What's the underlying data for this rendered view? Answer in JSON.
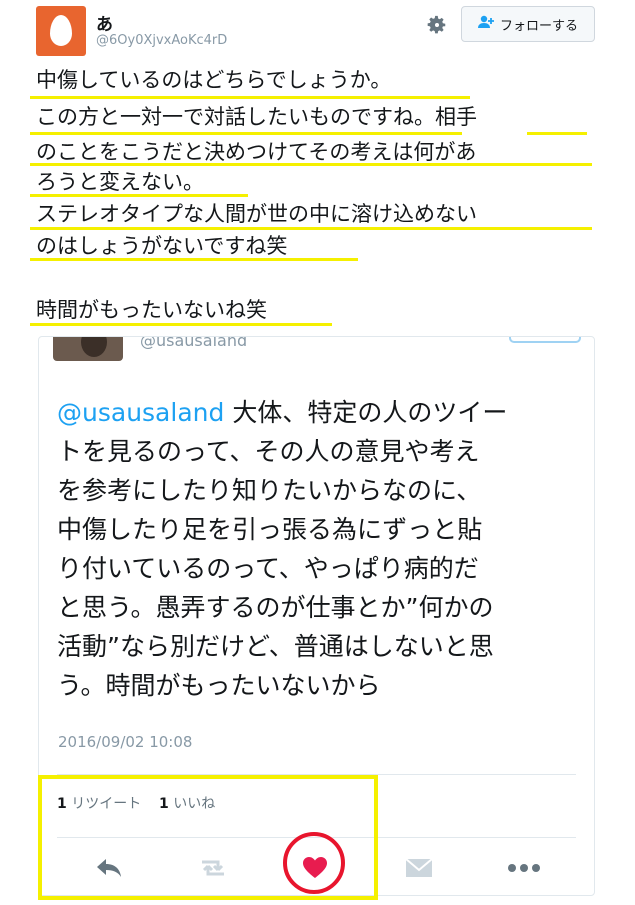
{
  "header": {
    "display_name": "あ",
    "handle": "@6Oy0XjvxAoKc4rD",
    "follow_label": "フォローする"
  },
  "tweet": {
    "lines": [
      "中傷しているのはどちらでしょうか。",
      "この方と一対一で対話したいものですね。相手",
      "のことをこうだと決めつけてその考えは何があ",
      "ろうと変えない。",
      "ステレオタイプな人間が世の中に溶け込めない",
      "のはしょうがないですね笑",
      "時間がもったいないね笑"
    ]
  },
  "quoted_tweet": {
    "handle": "@usausaland",
    "mention": "@usausaland",
    "lines": [
      "大体、特定の人のツイー",
      "トを見るのって、その人の意見や考え",
      "を参考にしたり知りたいからなのに、",
      "中傷したり足を引っ張る為にずっと貼",
      "り付いているのって、やっぱり病的だ",
      "と思う。愚弄するのが仕事とか”何かの",
      "活動”なら別だけど、普通はしないと思",
      "う。時間がもったいないから"
    ],
    "date": "2016/09/02 10:08",
    "retweet_count": "1",
    "retweet_label": "リツイート",
    "like_count": "1",
    "like_label": "いいね"
  },
  "icons": {
    "reply": "reply-icon",
    "retweet": "retweet-icon",
    "like": "heart-icon",
    "dm": "envelope-icon",
    "more": "more-icon",
    "settings": "gear-icon",
    "follow": "add-user-icon"
  },
  "colors": {
    "highlight": "#f5f000",
    "like": "#e81c4f",
    "circle": "#e8152d",
    "link": "#1da1f2"
  }
}
